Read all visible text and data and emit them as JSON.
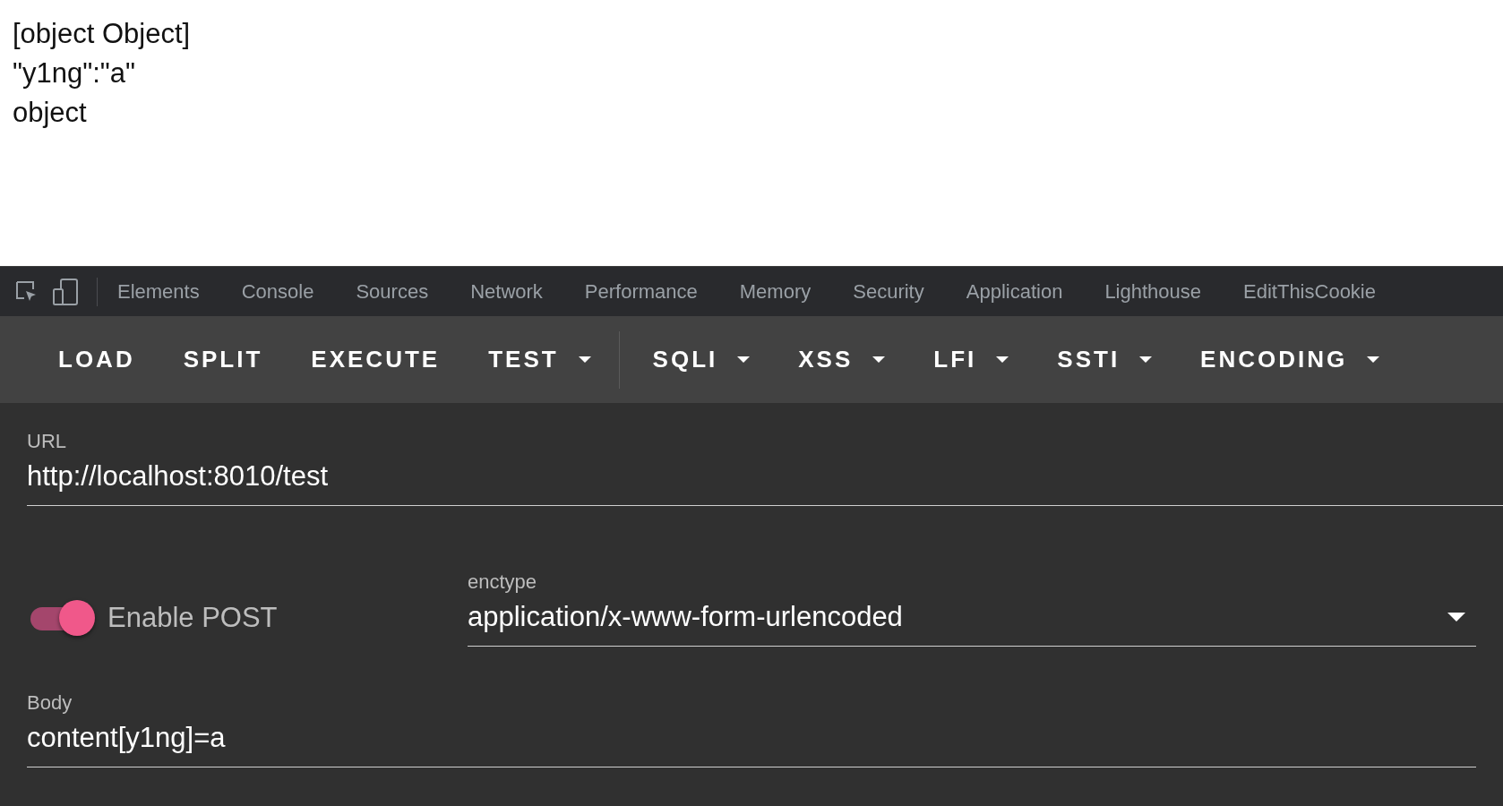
{
  "page_output": {
    "lines": [
      "[object Object]",
      "\"y1ng\":\"a\"",
      "object"
    ]
  },
  "devtools_tabs": [
    {
      "label": "Elements"
    },
    {
      "label": "Console"
    },
    {
      "label": "Sources"
    },
    {
      "label": "Network"
    },
    {
      "label": "Performance"
    },
    {
      "label": "Memory"
    },
    {
      "label": "Security"
    },
    {
      "label": "Application"
    },
    {
      "label": "Lighthouse"
    },
    {
      "label": "EditThisCookie"
    }
  ],
  "toolbar": [
    {
      "kind": "button",
      "label": "LOAD"
    },
    {
      "kind": "button",
      "label": "SPLIT"
    },
    {
      "kind": "button",
      "label": "EXECUTE"
    },
    {
      "kind": "menu",
      "label": "TEST"
    },
    {
      "kind": "divider"
    },
    {
      "kind": "menu",
      "label": "SQLI"
    },
    {
      "kind": "menu",
      "label": "XSS"
    },
    {
      "kind": "menu",
      "label": "LFI"
    },
    {
      "kind": "menu",
      "label": "SSTI"
    },
    {
      "kind": "menu",
      "label": "ENCODING"
    }
  ],
  "url": {
    "label": "URL",
    "value": "http://localhost:8010/test"
  },
  "post": {
    "label": "Enable POST",
    "on": true
  },
  "enctype": {
    "label": "enctype",
    "value": "application/x-www-form-urlencoded"
  },
  "body": {
    "label": "Body",
    "value": "content[y1ng]=a"
  }
}
